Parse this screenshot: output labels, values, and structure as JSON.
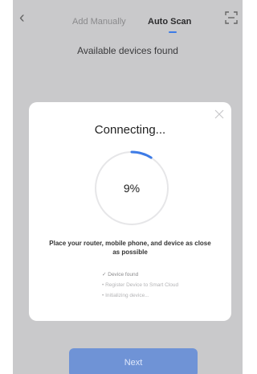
{
  "header": {
    "back_icon": "chevron-left-icon",
    "tabs": [
      {
        "label": "Add Manually",
        "active": false
      },
      {
        "label": "Auto Scan",
        "active": true
      }
    ],
    "scan_icon": "scan-frame-icon"
  },
  "subtitle": "Available devices found",
  "modal": {
    "title": "Connecting...",
    "progress_percent": 9,
    "progress_label": "9%",
    "hint": "Place your router, mobile phone, and device as close as possible",
    "steps": [
      {
        "label": "✓ Device found",
        "done": true
      },
      {
        "label": "• Register Device to Smart Cloud",
        "done": false
      },
      {
        "label": "• Initializing device...",
        "done": false
      }
    ]
  },
  "next_button": {
    "label": "Next"
  },
  "colors": {
    "accent": "#3d7be6",
    "button": "#6f93d6",
    "overlay": "#c9c9cb"
  }
}
